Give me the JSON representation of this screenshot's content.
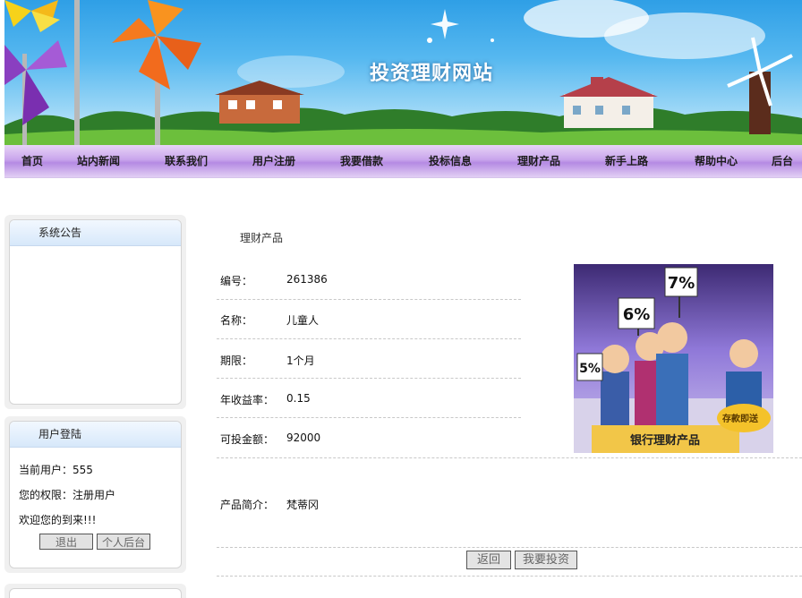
{
  "site": {
    "title": "投资理财网站"
  },
  "nav": {
    "items": [
      "首页",
      "站内新闻",
      "联系我们",
      "用户注册",
      "我要借款",
      "投标信息",
      "理财产品",
      "新手上路",
      "帮助中心",
      "后台"
    ]
  },
  "sidebar": {
    "notice": {
      "title": "系统公告"
    },
    "login": {
      "title": "用户登陆",
      "current_user": "当前用户：555",
      "permission": "您的权限：注册用户",
      "welcome": "欢迎您的到来!!!",
      "logout_label": "退出",
      "personal_label": "个人后台"
    }
  },
  "main": {
    "breadcrumb": "理财产品",
    "fields": [
      {
        "label": "编号：",
        "value": "261386"
      },
      {
        "label": "名称：",
        "value": "儿童人"
      },
      {
        "label": "期限：",
        "value": "1个月"
      },
      {
        "label": "年收益率：",
        "value": "0.15"
      },
      {
        "label": "可投金额：",
        "value": "92000"
      }
    ],
    "intro": {
      "label": "产品简介：",
      "value": "梵蒂冈"
    },
    "image_text": {
      "p5": "5%",
      "p6": "6%",
      "p7": "7%",
      "bank": "银行理财产品",
      "deposit": "存款即送"
    },
    "back_label": "返回",
    "invest_label": "我要投资"
  },
  "colors": {
    "nav_accent": "#c9a5ec",
    "sky": "#56b8f0",
    "box_head": "#d7e8fa"
  }
}
